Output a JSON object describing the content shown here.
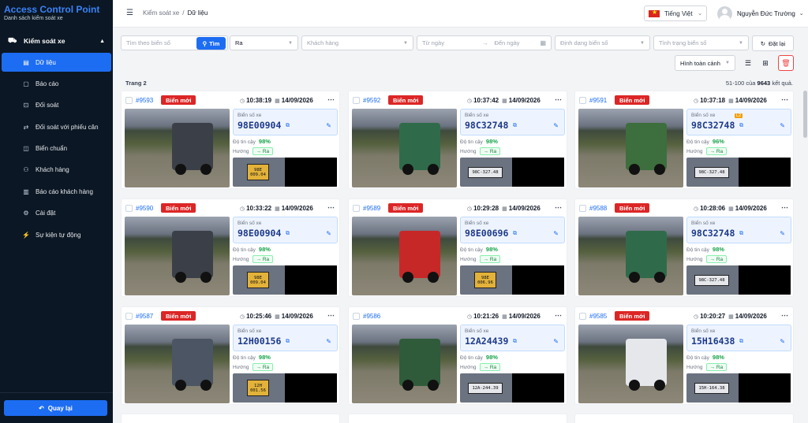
{
  "app": {
    "title": "Access Control Point",
    "subtitle": "Danh sách kiểm soát xe"
  },
  "sidebar": {
    "group_label": "Kiểm soát xe",
    "items": [
      {
        "label": "Dữ liệu",
        "icon": "database-icon",
        "active": true
      },
      {
        "label": "Báo cáo",
        "icon": "report-icon"
      },
      {
        "label": "Đối soát",
        "icon": "reconcile-icon"
      },
      {
        "label": "Đối soát với phiếu cân",
        "icon": "scale-ticket-icon"
      },
      {
        "label": "Biển chuẩn",
        "icon": "standard-plate-icon"
      },
      {
        "label": "Khách hàng",
        "icon": "customer-icon"
      },
      {
        "label": "Báo cáo khách hàng",
        "icon": "customer-report-icon"
      },
      {
        "label": "Cài đặt",
        "icon": "settings-icon"
      },
      {
        "label": "Sự kiện tự động",
        "icon": "auto-event-icon"
      }
    ],
    "back_label": "Quay lại"
  },
  "header": {
    "breadcrumb": [
      "Kiểm soát xe",
      "Dữ liệu"
    ],
    "language": "Tiếng Việt",
    "user_name": "Nguyễn Đức Trường"
  },
  "filters": {
    "plate_placeholder": "Tìm theo biển số",
    "search_label": "Tìm",
    "direction_value": "Ra",
    "customer_placeholder": "Khách hàng",
    "from_date_placeholder": "Từ ngày",
    "to_date_placeholder": "Đến ngày",
    "plate_format_placeholder": "Định dạng biển số",
    "plate_status_placeholder": "Tình trạng biển số",
    "reset_label": "Đặt lại",
    "view_mode": "Hình toàn cảnh"
  },
  "list": {
    "page_label": "Trang 2",
    "range": "51-100",
    "of_label": "của",
    "total": "9643",
    "results_label": "kết quả."
  },
  "card_labels": {
    "plate_label": "Biển số xe",
    "confidence_label": "Độ tin cậy",
    "direction_label": "Hướng"
  },
  "cards": [
    {
      "id": "#9593",
      "badge": "Biển mới",
      "time": "10:38:19",
      "date": "14/09/2026",
      "plate": "98E00904",
      "confidence": "98%",
      "direction": "→ Ra",
      "crop_text": "98E 009.04",
      "truck_color": "#3b4048",
      "plate_style": "yellow"
    },
    {
      "id": "#9592",
      "badge": "Biển mới",
      "time": "10:37:42",
      "date": "14/09/2026",
      "plate": "98C32748",
      "confidence": "98%",
      "direction": "→ Ra",
      "crop_text": "98C-327.48",
      "truck_color": "#2f6b4a",
      "plate_style": "white"
    },
    {
      "id": "#9591",
      "badge": "Biển mới",
      "time": "10:37:18",
      "date": "14/09/2026",
      "plate": "98C32748",
      "confidence": "96%",
      "direction": "→ Ra",
      "crop_text": "98C-327.48",
      "truck_color": "#3d6e3d",
      "plate_style": "white",
      "tag": "L2"
    },
    {
      "id": "#9590",
      "badge": "Biển mới",
      "time": "10:33:22",
      "date": "14/09/2026",
      "plate": "98E00904",
      "confidence": "98%",
      "direction": "→ Ra",
      "crop_text": "98E 009.04",
      "truck_color": "#3b4048",
      "plate_style": "yellow"
    },
    {
      "id": "#9589",
      "badge": "Biển mới",
      "time": "10:29:28",
      "date": "14/09/2026",
      "plate": "98E00696",
      "confidence": "98%",
      "direction": "→ Ra",
      "crop_text": "98E 006.96",
      "truck_color": "#c62828",
      "plate_style": "yellow"
    },
    {
      "id": "#9588",
      "badge": "Biển mới",
      "time": "10:28:06",
      "date": "14/09/2026",
      "plate": "98C32748",
      "confidence": "98%",
      "direction": "→ Ra",
      "crop_text": "98C-327.48",
      "truck_color": "#2f6b4a",
      "plate_style": "white"
    },
    {
      "id": "#9587",
      "badge": "Biển mới",
      "time": "10:25:46",
      "date": "14/09/2026",
      "plate": "12H00156",
      "confidence": "98%",
      "direction": "→ Ra",
      "crop_text": "12H 001.56",
      "truck_color": "#4b5563",
      "plate_style": "yellow"
    },
    {
      "id": "#9586",
      "badge": "",
      "time": "10:21:26",
      "date": "14/09/2026",
      "plate": "12A24439",
      "confidence": "98%",
      "direction": "→ Ra",
      "crop_text": "12A-244.39",
      "truck_color": "#2f5b3a",
      "plate_style": "white"
    },
    {
      "id": "#9585",
      "badge": "Biển mới",
      "time": "10:20:27",
      "date": "14/09/2026",
      "plate": "15H16438",
      "confidence": "98%",
      "direction": "→ Ra",
      "crop_text": "15H-164.38",
      "truck_color": "#e5e7eb",
      "plate_style": "white"
    }
  ],
  "colors": {
    "accent": "#1d6df2",
    "badge_red": "#dc2626",
    "confidence_green": "#16a34a",
    "sidebar_bg": "#0b1724",
    "brand_blue": "#3b82f6"
  }
}
